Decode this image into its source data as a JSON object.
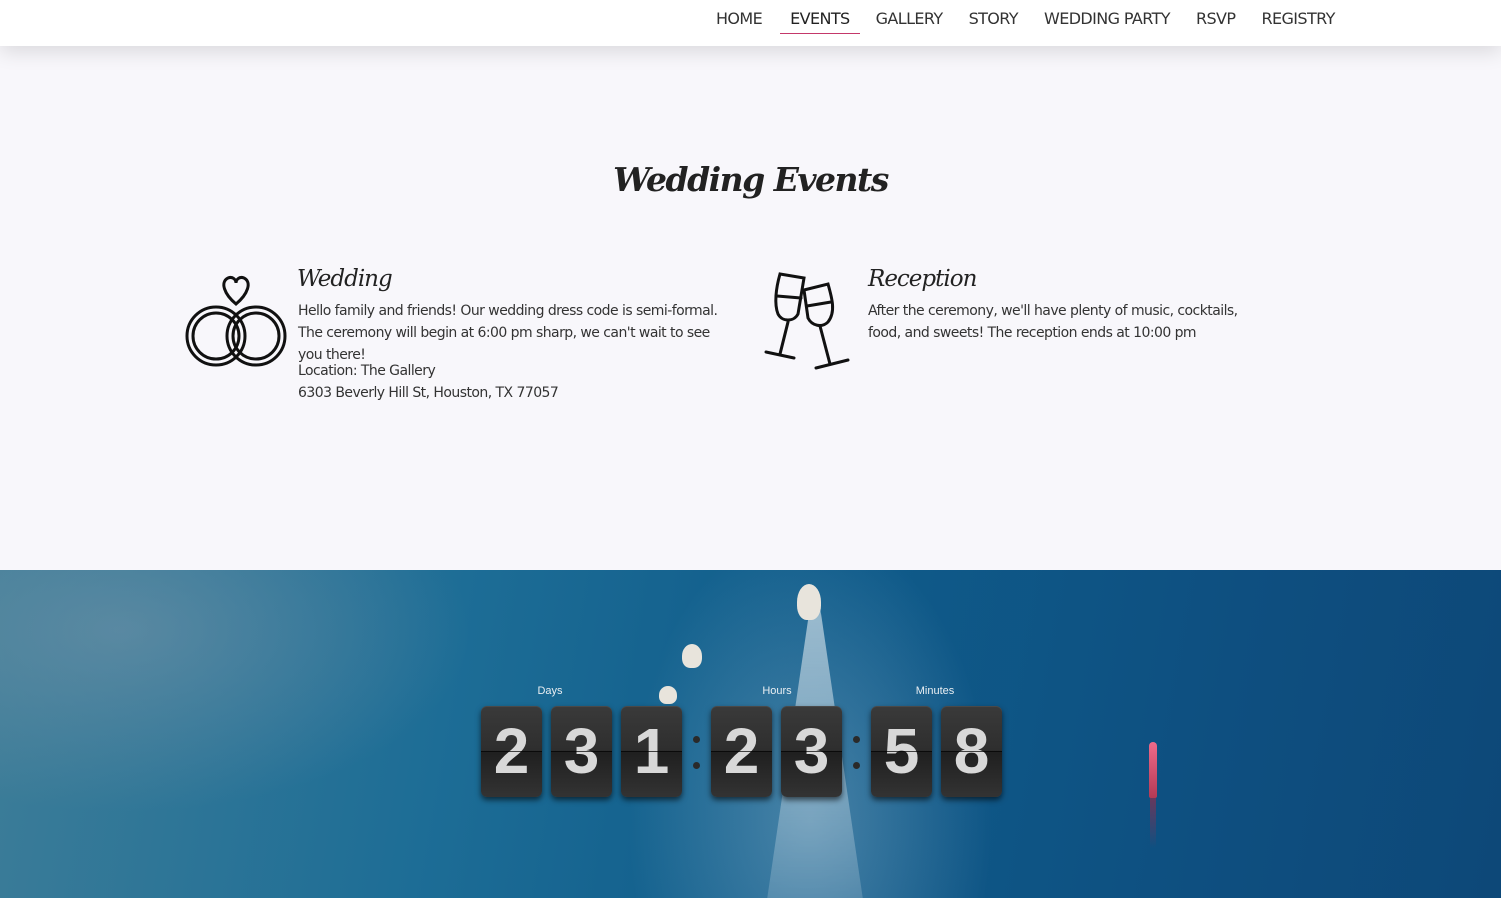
{
  "nav": {
    "items": [
      {
        "label": "HOME"
      },
      {
        "label": "EVENTS",
        "active": true
      },
      {
        "label": "GALLERY"
      },
      {
        "label": "STORY"
      },
      {
        "label": "WEDDING PARTY"
      },
      {
        "label": "RSVP"
      },
      {
        "label": "REGISTRY"
      }
    ],
    "active_color": "#c4386a"
  },
  "events": {
    "title": "Wedding Events",
    "wedding": {
      "icon": "wedding-rings-icon",
      "title": "Wedding",
      "description": "Hello family and friends! Our wedding dress code is semi-formal. The ceremony will begin at 6:00 pm sharp, we can't wait to see you there!",
      "location": "Location: The Gallery",
      "address": "6303 Beverly Hill St, Houston, TX 77057"
    },
    "reception": {
      "icon": "champagne-glasses-icon",
      "title": "Reception",
      "description": "After the ceremony, we'll have plenty of music, cocktails, food, and sweets! The reception ends at 10:00 pm"
    }
  },
  "countdown": {
    "labels": {
      "days": "Days",
      "hours": "Hours",
      "minutes": "Minutes"
    },
    "days": [
      "2",
      "3",
      "1"
    ],
    "hours": [
      "2",
      "3"
    ],
    "minutes": [
      "5",
      "8"
    ]
  }
}
